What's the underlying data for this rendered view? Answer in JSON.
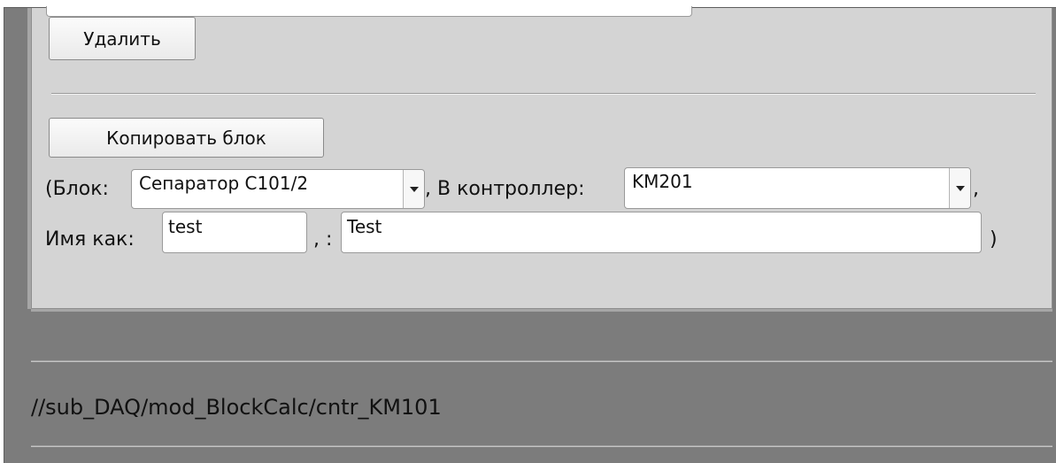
{
  "panel": {
    "delete_button": "Удалить",
    "copy_button": "Копировать блок",
    "block_prefix": "(Блок:",
    "block_select_value": "Сепаратор C101/2",
    "controller_label": ", В контроллер:",
    "controller_select_value": "KM201",
    "controller_suffix": ",",
    "name_label": "Имя как:",
    "name_value": "test",
    "desc_separator": ", :",
    "desc_value": "Test",
    "close_paren": ")"
  },
  "footer": {
    "path": "//sub_DAQ/mod_BlockCalc/cntr_KM101"
  },
  "icons": {
    "dropdown": "chevron-down-icon"
  }
}
